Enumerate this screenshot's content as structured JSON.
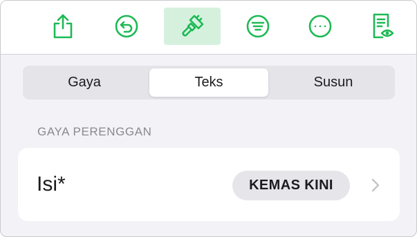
{
  "toolbar": {
    "accent_color": "#1db954",
    "active_bg": "#d5f1de",
    "items": [
      {
        "icon": "share-icon"
      },
      {
        "icon": "undo-icon"
      },
      {
        "icon": "paintbrush-icon",
        "active": true
      },
      {
        "icon": "insert-list-icon"
      },
      {
        "icon": "more-icon"
      },
      {
        "icon": "reader-view-icon"
      }
    ]
  },
  "segments": {
    "items": [
      {
        "label": "Gaya"
      },
      {
        "label": "Teks",
        "selected": true
      },
      {
        "label": "Susun"
      }
    ]
  },
  "section": {
    "header": "GAYA PERENGGAN"
  },
  "paragraph_style": {
    "name": "Isi*",
    "update_label": "KEMAS KINI",
    "disclosure_icon": "chevron-right-icon"
  }
}
